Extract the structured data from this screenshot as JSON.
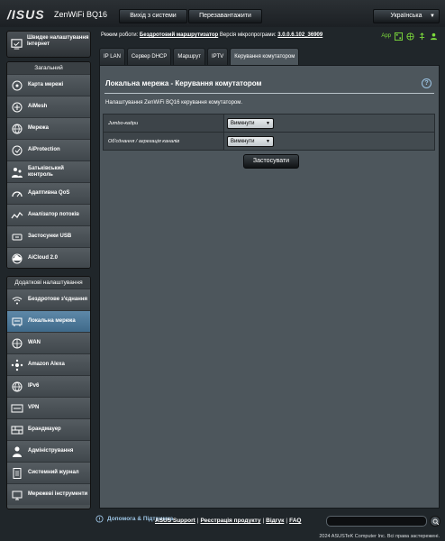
{
  "header": {
    "brand": "/ISUS",
    "model": "ZenWiFi BQ16",
    "logout_label": "Вихід з системи",
    "reboot_label": "Перезавантажити",
    "language": "Українська"
  },
  "status": {
    "mode_label": "Режим роботи:",
    "mode_value": "Бездротовий маршрутизатор",
    "firmware_label": "Версія мікропрограми:",
    "firmware_value": "3.0.0.6.102_36909",
    "app_label": "App"
  },
  "sidebar": {
    "quick_setup": "Швидке налаштування Інтернет",
    "general_title": "Загальний",
    "general_items": [
      {
        "label": "Карта мережі",
        "icon": "network-map-icon"
      },
      {
        "label": "AiMesh",
        "icon": "aimesh-icon"
      },
      {
        "label": "Мережа",
        "icon": "network-icon"
      },
      {
        "label": "AiProtection",
        "icon": "aiprotection-icon"
      },
      {
        "label": "Батьківський контроль",
        "icon": "parental-control-icon"
      },
      {
        "label": "Адаптивна QoS",
        "icon": "qos-icon"
      },
      {
        "label": "Аналізатор потоків",
        "icon": "traffic-analyzer-icon"
      },
      {
        "label": "Застосунки USB",
        "icon": "usb-icon"
      },
      {
        "label": "AiCloud 2.0",
        "icon": "aicloud-icon"
      }
    ],
    "advanced_title": "Додаткові налаштування",
    "advanced_items": [
      {
        "label": "Бездротове з'єднання",
        "icon": "wireless-icon"
      },
      {
        "label": "Локальна мережа",
        "icon": "lan-icon"
      },
      {
        "label": "WAN",
        "icon": "wan-icon"
      },
      {
        "label": "Amazon Alexa",
        "icon": "alexa-icon"
      },
      {
        "label": "IPv6",
        "icon": "ipv6-icon"
      },
      {
        "label": "VPN",
        "icon": "vpn-icon"
      },
      {
        "label": "Брандмауер",
        "icon": "firewall-icon"
      },
      {
        "label": "Адміністрування",
        "icon": "administration-icon"
      },
      {
        "label": "Системний журнал",
        "icon": "system-log-icon"
      },
      {
        "label": "Мережеві інструменти",
        "icon": "network-tools-icon"
      }
    ]
  },
  "tabs": [
    "IP LAN",
    "Сервер DHCP",
    "Маршрут",
    "IPTV",
    "Керування комутатором"
  ],
  "main": {
    "title": "Локальна мережа - Керування комутатором",
    "help": "?",
    "description": "Налаштування ZenWiFi BQ16 керування комутатором.",
    "settings": [
      {
        "label": "Jumbo-кадри",
        "value": "Вимкнути"
      },
      {
        "label": "Об'єднання / агрегація каналів",
        "value": "Вимкнути"
      }
    ],
    "apply_label": "Застосувати"
  },
  "footer": {
    "help_support": "Допомога & Підтримка",
    "links": [
      "ASUS Support",
      "Реєстрація продукту",
      "Відгук",
      "FAQ"
    ],
    "copyright": "2024 ASUSTeK Computer Inc. Всі права застережені."
  },
  "colors": {
    "background": "#20262a",
    "panel": "#4d565c",
    "active_nav": "#4f7a9a",
    "accent_link": "#9cc4e4",
    "status_green": "#7ddc3c"
  }
}
